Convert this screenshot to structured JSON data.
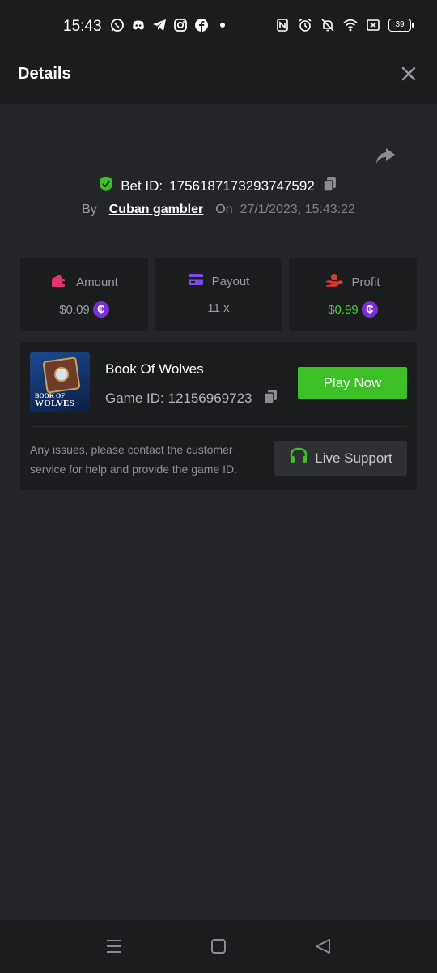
{
  "status_bar": {
    "time": "15:43",
    "left_icons": [
      "whatsapp-icon",
      "discord-icon",
      "telegram-icon",
      "instagram-icon",
      "facebook-icon",
      "dot-icon"
    ],
    "right_icons": [
      "nfc-icon",
      "alarm-icon",
      "mute-icon",
      "wifi-icon",
      "sim-icon"
    ],
    "battery": "39"
  },
  "header": {
    "title": "Details",
    "close_icon": "close-icon"
  },
  "bet": {
    "id_label": "Bet ID:",
    "id_value": "1756187173293747592",
    "by_label": "By",
    "user": "Cuban gambler",
    "on_label": "On",
    "datetime": "27/1/2023, 15:43:22"
  },
  "stats": {
    "amount": {
      "label": "Amount",
      "value": "$0.09",
      "icon": "wallet-icon",
      "icon_color": "#e5336d"
    },
    "payout": {
      "label": "Payout",
      "value": "11 x",
      "icon": "card-icon",
      "icon_color": "#7d4be6"
    },
    "profit": {
      "label": "Profit",
      "value": "$0.99",
      "icon": "hand-money-icon",
      "icon_color": "#e2362f",
      "value_color": "#3fd23a"
    },
    "coin_symbol": "₵"
  },
  "game": {
    "name": "Book Of Wolves",
    "id_label": "Game ID:",
    "id_value": "12156969723",
    "thumb_line1": "BOOK OF",
    "thumb_line2": "WOLVES",
    "play_label": "Play Now",
    "issue_text": "Any issues, please contact the customer service for help and provide the game ID.",
    "support_label": "Live Support"
  },
  "colors": {
    "accent_green": "#3dbf26",
    "coin_purple": "#7b2fd6",
    "background": "#232528",
    "panel": "#1b1c1e"
  }
}
